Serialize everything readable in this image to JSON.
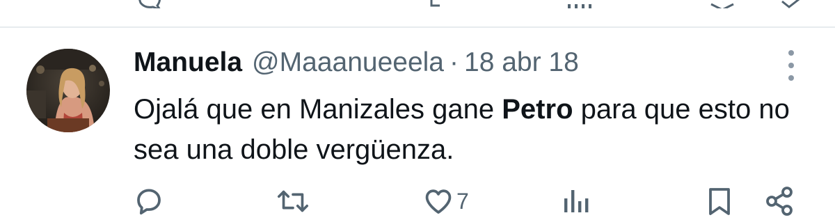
{
  "tweet": {
    "author": {
      "display_name": "Manuela",
      "handle": "@Maaanueeela"
    },
    "separator": "·",
    "date": "18 abr 18",
    "text": {
      "part1": "Ojalá que en Manizales gane ",
      "bold": "Petro",
      "part2": " para que esto no sea una doble vergüenza."
    },
    "actions": {
      "reply_count": "",
      "retweet_count": "",
      "like_count": "7",
      "views_count": ""
    }
  },
  "icons": {
    "reply": "reply-bubble-icon",
    "retweet": "retweet-icon",
    "like": "heart-icon",
    "views": "bar-chart-icon",
    "bookmark": "bookmark-icon",
    "share": "share-icon",
    "more": "more-vertical-icon"
  },
  "colors": {
    "text_primary": "#0f1419",
    "text_secondary": "#536471",
    "icon": "#536471",
    "divider": "#e7ebee"
  }
}
